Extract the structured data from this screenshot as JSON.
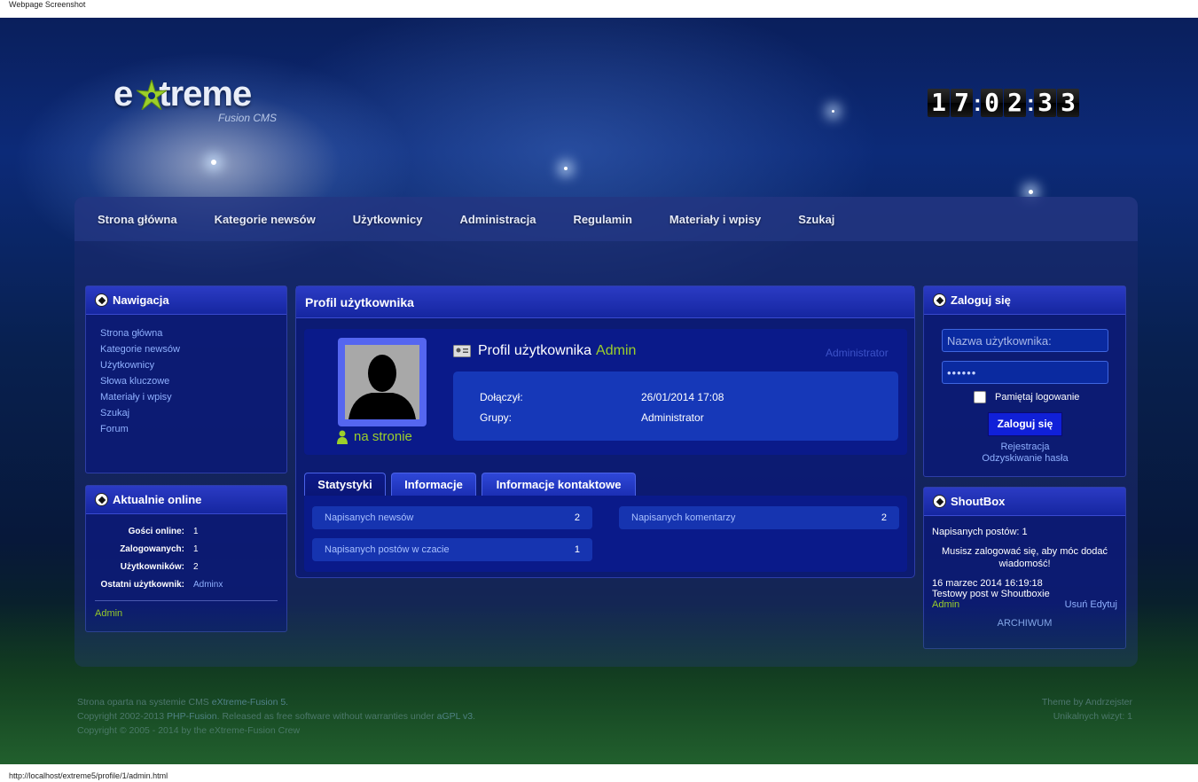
{
  "caption": "Webpage Screenshot",
  "url": "http://localhost/extreme5/profile/1/admin.html",
  "logo": {
    "main": "extreme",
    "sub": "Fusion CMS"
  },
  "clock": {
    "h1": "1",
    "h2": "7",
    "m1": "0",
    "m2": "2",
    "s1": "3",
    "s2": "3"
  },
  "nav": [
    "Strona główna",
    "Kategorie newsów",
    "Użytkownicy",
    "Administracja",
    "Regulamin",
    "Materiały i wpisy",
    "Szukaj"
  ],
  "left_nav": {
    "title": "Nawigacja",
    "items": [
      "Strona główna",
      "Kategorie newsów",
      "Użytkownicy",
      "Słowa kluczowe",
      "Materiały i wpisy",
      "Szukaj",
      "Forum"
    ]
  },
  "online": {
    "title": "Aktualnie online",
    "rows": [
      {
        "label": "Gości online:",
        "value": "1"
      },
      {
        "label": "Zalogowanych:",
        "value": "1"
      },
      {
        "label": "Użytkowników:",
        "value": "2"
      },
      {
        "label": "Ostatni użytkownik:",
        "value": "Adminx"
      }
    ],
    "user": "Admin"
  },
  "profile": {
    "panel_title": "Profil użytkownika",
    "heading": "Profil użytkownika",
    "username": "Admin",
    "role_label": "Administrator",
    "status": "na stronie",
    "joined_label": "Dołączył:",
    "joined_value": "26/01/2014 17:08",
    "groups_label": "Grupy:",
    "groups_value": "Administrator",
    "tabs": [
      "Statystyki",
      "Informacje",
      "Informacje kontaktowe"
    ],
    "stats": [
      {
        "label": "Napisanych newsów",
        "value": "2"
      },
      {
        "label": "Napisanych komentarzy",
        "value": "2"
      },
      {
        "label": "Napisanych postów w czacie",
        "value": "1"
      }
    ]
  },
  "login": {
    "title": "Zaloguj się",
    "username_placeholder": "Nazwa użytkownika:",
    "password_value": "••••••",
    "remember": "Pamiętaj logowanie",
    "submit": "Zaloguj się",
    "register": "Rejestracja",
    "recover": "Odzyskiwanie hasła"
  },
  "shoutbox": {
    "title": "ShoutBox",
    "count": "Napisanych postów: 1",
    "notice": "Musisz zalogować się, aby móc dodać wiadomość!",
    "date": "16 marzec 2014 16:19:18",
    "message": "Testowy post w Shoutboxie",
    "author": "Admin",
    "delete": "Usuń",
    "edit": "Edytuj",
    "archive": "ARCHIWUM"
  },
  "footer": {
    "l1a": "Strona oparta na systemie CMS ",
    "l1b": "eXtreme-Fusion 5.",
    "l2a": "Copyright 2002-2013 ",
    "l2b": "PHP-Fusion",
    "l2c": ". Released as free software without warranties under ",
    "l2d": "aGPL v3",
    "l2e": ".",
    "l3": "Copyright © 2005 - 2014 by the eXtreme-Fusion Crew",
    "r1a": "Theme by ",
    "r1b": "Andrzejster",
    "r2": "Unikalnych wizyt: 1"
  },
  "colors": {
    "accent_green": "#9ccf2a",
    "link_blue": "#8fb0ff",
    "panel_blue": "#1526a0"
  }
}
